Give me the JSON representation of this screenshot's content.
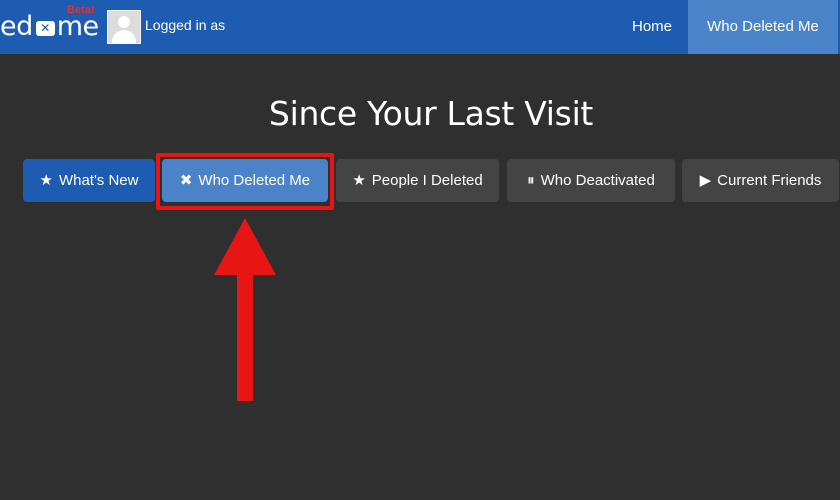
{
  "app": {
    "logo_text_left": "ed",
    "logo_mark": "✕",
    "logo_text_right": "me",
    "beta_label": "Beta!"
  },
  "header": {
    "logged_in_text": "Logged in as",
    "nav": [
      {
        "label": "Home"
      },
      {
        "label": "Who Deleted Me"
      }
    ]
  },
  "main": {
    "heading": "Since Your Last Visit",
    "tabs": [
      {
        "label": "What's New",
        "icon": "star-icon",
        "glyph": "★"
      },
      {
        "label": "Who Deleted Me",
        "icon": "close-icon",
        "glyph": "✖"
      },
      {
        "label": "People I Deleted",
        "icon": "star-icon",
        "glyph": "★"
      },
      {
        "label": "Who Deactivated",
        "icon": "pause-icon",
        "glyph": "⏸"
      },
      {
        "label": "Current Friends",
        "icon": "play-icon",
        "glyph": "▶"
      }
    ]
  },
  "colors": {
    "navbar": "#1d5cb0",
    "active": "#4a83c8",
    "background": "#2f2f2f",
    "annotation": "#e81515"
  }
}
